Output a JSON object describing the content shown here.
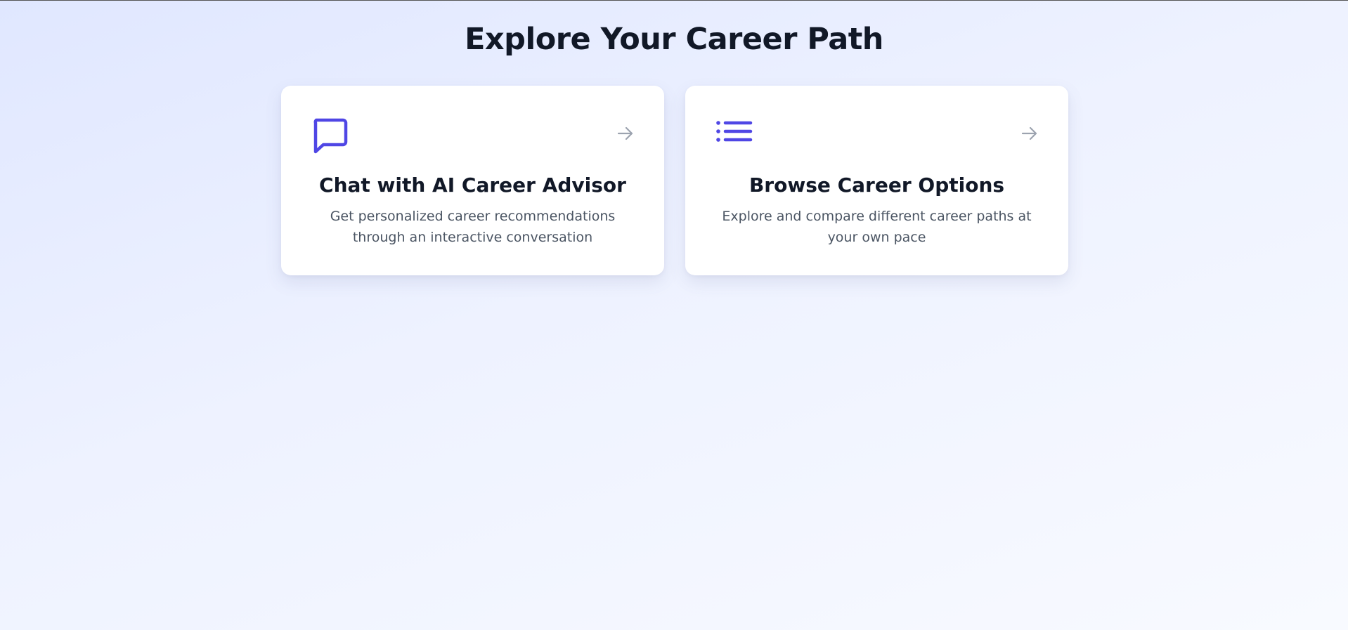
{
  "page": {
    "title": "Explore Your Career Path"
  },
  "cards": [
    {
      "icon": "chat-bubble-icon",
      "title": "Chat with AI Career Advisor",
      "description": "Get personalized career recommendations through an interactive conversation",
      "arrow_icon": "arrow-right-icon"
    },
    {
      "icon": "list-icon",
      "title": "Browse Career Options",
      "description": "Explore and compare different career paths at your own pace",
      "arrow_icon": "arrow-right-icon"
    }
  ],
  "colors": {
    "accent": "#4f46e5",
    "title": "#111827",
    "muted_text": "#4b5563",
    "arrow": "#9ca3af"
  }
}
